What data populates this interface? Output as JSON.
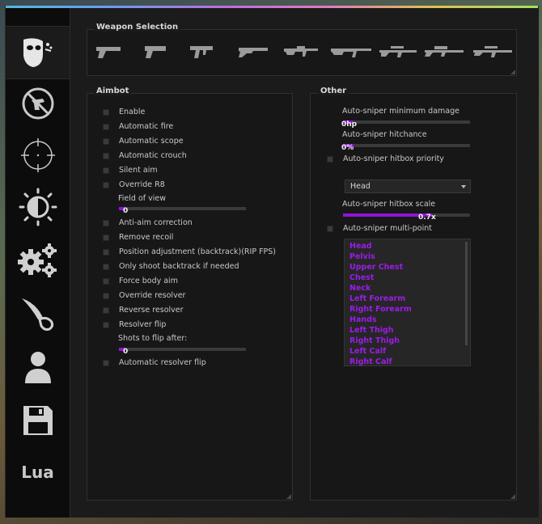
{
  "colors": {
    "accent": "#8e14d6",
    "list_accent": "#9b1ce8",
    "window_bg": "#0f0f0f",
    "panel_bg": "#171717"
  },
  "sidebar": {
    "tabs": [
      {
        "name": "rage-tab",
        "icon": "masked-face-icon",
        "active": true
      },
      {
        "name": "anti-aim-tab",
        "icon": "no-shooting-icon"
      },
      {
        "name": "legit-tab",
        "icon": "crosshair-icon"
      },
      {
        "name": "visuals-tab",
        "icon": "brightness-icon"
      },
      {
        "name": "misc-tab",
        "icon": "gears-icon"
      },
      {
        "name": "skins-tab",
        "icon": "knife-icon"
      },
      {
        "name": "players-tab",
        "icon": "user-icon"
      },
      {
        "name": "config-tab",
        "icon": "save-icon"
      },
      {
        "name": "lua-tab",
        "icon": "lua-text",
        "label": "Lua"
      }
    ]
  },
  "weapon_selection": {
    "title": "Weapon Selection",
    "weapons": [
      "pistol-icon",
      "heavy-pistol-icon",
      "smg-icon",
      "shotgun-icon",
      "rifle-icon",
      "ak-rifle-icon",
      "auto-sniper-icon",
      "awp-icon",
      "scout-icon"
    ]
  },
  "aimbot": {
    "title": "Aimbot",
    "items": [
      {
        "label": "Enable"
      },
      {
        "label": "Automatic fire"
      },
      {
        "label": "Automatic scope"
      },
      {
        "label": "Automatic crouch"
      },
      {
        "label": "Silent aim"
      },
      {
        "label": "Override R8"
      }
    ],
    "fov": {
      "label": "Field of view",
      "value": "0",
      "fraction": 0.05
    },
    "items2": [
      {
        "label": "Anti-aim correction"
      },
      {
        "label": "Remove recoil"
      },
      {
        "label": "Position adjustment (backtrack)(RIP FPS)"
      },
      {
        "label": "Only shoot backtrack if needed"
      },
      {
        "label": "Force body aim"
      },
      {
        "label": "Override resolver"
      },
      {
        "label": "Reverse resolver"
      },
      {
        "label": "Resolver flip"
      }
    ],
    "flip": {
      "label": "Shots to flip after:",
      "value": "0",
      "fraction": 0.05
    },
    "last_item": {
      "label": "Automatic resolver flip"
    }
  },
  "other": {
    "title": "Other",
    "min_damage": {
      "label": "Auto-sniper minimum damage",
      "value": "0hp",
      "fraction": 0.08
    },
    "hitchance": {
      "label": "Auto-sniper hitchance",
      "value": "0%",
      "fraction": 0.08
    },
    "hitbox_priority": {
      "label": "Auto-sniper hitbox priority"
    },
    "hitbox_select": {
      "value": "Head"
    },
    "hitbox_scale": {
      "label": "Auto-sniper hitbox scale",
      "value": "0.7x",
      "fraction": 0.7
    },
    "multipoint": {
      "label": "Auto-sniper multi-point"
    },
    "hitboxes": [
      "Head",
      "Pelvis",
      "Upper Chest",
      "Chest",
      "Neck",
      "Left Forearm",
      "Right Forearm",
      "Hands",
      "Left Thigh",
      "Right Thigh",
      "Left Calf",
      "Right Calf"
    ]
  }
}
